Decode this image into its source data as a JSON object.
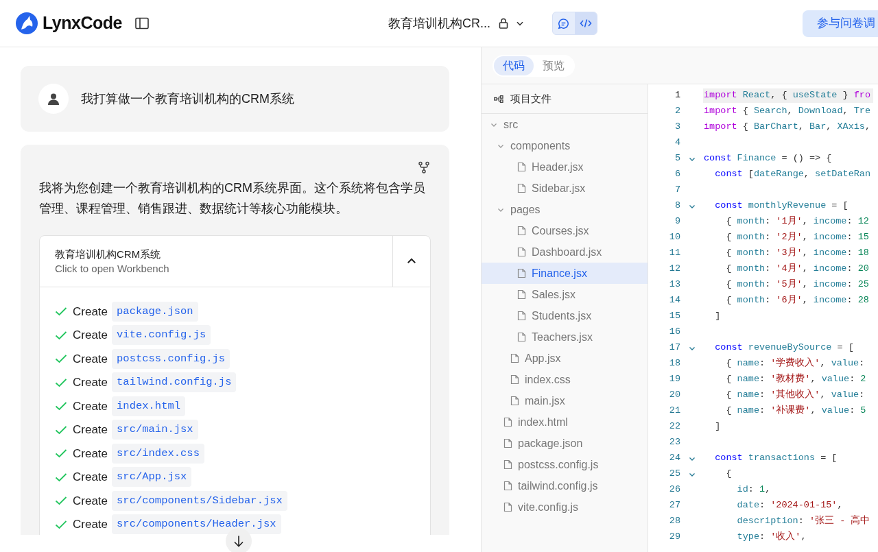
{
  "header": {
    "logo": "LynxCode",
    "project_title": "教育培训机构CR...",
    "view_toggle": [
      {
        "kind": "chat",
        "selected": false
      },
      {
        "kind": "code",
        "selected": true
      }
    ],
    "survey_button": "参与问卷调"
  },
  "chat": {
    "user_message": "我打算做一个教育培训机构的CRM系统",
    "assistant_message": "我将为您创建一个教育培训机构的CRM系统界面。这个系统将包含学员管理、课程管理、销售跟进、数据统计等核心功能模块。",
    "workbench": {
      "title": "教育培训机构CRM系统",
      "subtitle": "Click to open Workbench",
      "expanded": true,
      "steps": [
        {
          "action": "Create",
          "file": "package.json",
          "done": true
        },
        {
          "action": "Create",
          "file": "vite.config.js",
          "done": true
        },
        {
          "action": "Create",
          "file": "postcss.config.js",
          "done": true
        },
        {
          "action": "Create",
          "file": "tailwind.config.js",
          "done": true
        },
        {
          "action": "Create",
          "file": "index.html",
          "done": true
        },
        {
          "action": "Create",
          "file": "src/main.jsx",
          "done": true
        },
        {
          "action": "Create",
          "file": "src/index.css",
          "done": true
        },
        {
          "action": "Create",
          "file": "src/App.jsx",
          "done": true
        },
        {
          "action": "Create",
          "file": "src/components/Sidebar.jsx",
          "done": true
        },
        {
          "action": "Create",
          "file": "src/components/Header.jsx",
          "done": true
        }
      ]
    }
  },
  "tabs": [
    {
      "label": "代码",
      "selected": true
    },
    {
      "label": "预览",
      "selected": false
    }
  ],
  "file_tree": {
    "title": "项目文件",
    "items": [
      {
        "kind": "folder",
        "name": "src",
        "expanded": true,
        "children": [
          {
            "kind": "folder",
            "name": "components",
            "expanded": true,
            "children": [
              {
                "kind": "file",
                "name": "Header.jsx",
                "selected": false
              },
              {
                "kind": "file",
                "name": "Sidebar.jsx",
                "selected": false
              }
            ]
          },
          {
            "kind": "folder",
            "name": "pages",
            "expanded": true,
            "children": [
              {
                "kind": "file",
                "name": "Courses.jsx",
                "selected": false
              },
              {
                "kind": "file",
                "name": "Dashboard.jsx",
                "selected": false
              },
              {
                "kind": "file",
                "name": "Finance.jsx",
                "selected": true
              },
              {
                "kind": "file",
                "name": "Sales.jsx",
                "selected": false
              },
              {
                "kind": "file",
                "name": "Students.jsx",
                "selected": false
              },
              {
                "kind": "file",
                "name": "Teachers.jsx",
                "selected": false
              }
            ]
          },
          {
            "kind": "file",
            "name": "App.jsx",
            "selected": false
          },
          {
            "kind": "file",
            "name": "index.css",
            "selected": false
          },
          {
            "kind": "file",
            "name": "main.jsx",
            "selected": false
          }
        ]
      },
      {
        "kind": "file",
        "name": "index.html",
        "selected": false
      },
      {
        "kind": "file",
        "name": "package.json",
        "selected": false
      },
      {
        "kind": "file",
        "name": "postcss.config.js",
        "selected": false
      },
      {
        "kind": "file",
        "name": "tailwind.config.js",
        "selected": false
      },
      {
        "kind": "file",
        "name": "vite.config.js",
        "selected": false
      }
    ]
  },
  "code": {
    "lines": [
      {
        "no": "1",
        "foldable": false,
        "current": true,
        "tokens": [
          {
            "kind": "kw",
            "text": "import"
          },
          {
            "kind": "id",
            "text": " React"
          },
          {
            "kind": "p",
            "text": ", { "
          },
          {
            "kind": "id",
            "text": "useState"
          },
          {
            "kind": "p",
            "text": " } "
          },
          {
            "kind": "kw",
            "text": "fro"
          }
        ]
      },
      {
        "no": "2",
        "foldable": false,
        "current": false,
        "tokens": [
          {
            "kind": "kw",
            "text": "import"
          },
          {
            "kind": "p",
            "text": " { "
          },
          {
            "kind": "id",
            "text": "Search"
          },
          {
            "kind": "p",
            "text": ", "
          },
          {
            "kind": "id",
            "text": "Download"
          },
          {
            "kind": "p",
            "text": ", "
          },
          {
            "kind": "id",
            "text": "Tre"
          }
        ]
      },
      {
        "no": "3",
        "foldable": false,
        "current": false,
        "tokens": [
          {
            "kind": "kw",
            "text": "import"
          },
          {
            "kind": "p",
            "text": " { "
          },
          {
            "kind": "id",
            "text": "BarChart"
          },
          {
            "kind": "p",
            "text": ", "
          },
          {
            "kind": "id",
            "text": "Bar"
          },
          {
            "kind": "p",
            "text": ", "
          },
          {
            "kind": "id",
            "text": "XAxis"
          },
          {
            "kind": "p",
            "text": ","
          }
        ]
      },
      {
        "no": "4",
        "foldable": false,
        "current": false
      },
      {
        "no": "5",
        "foldable": true,
        "current": false,
        "tokens": [
          {
            "kind": "decl",
            "text": "const"
          },
          {
            "kind": "id",
            "text": " Finance"
          },
          {
            "kind": "p",
            "text": " = () => {"
          }
        ]
      },
      {
        "no": "6",
        "foldable": false,
        "current": false,
        "tokens": [
          {
            "kind": "decl",
            "text": "  const"
          },
          {
            "kind": "p",
            "text": " ["
          },
          {
            "kind": "id",
            "text": "dateRange"
          },
          {
            "kind": "p",
            "text": ", "
          },
          {
            "kind": "id",
            "text": "setDateRan"
          }
        ]
      },
      {
        "no": "7",
        "foldable": false,
        "current": false
      },
      {
        "no": "8",
        "foldable": true,
        "current": false,
        "tokens": [
          {
            "kind": "decl",
            "text": "  const"
          },
          {
            "kind": "id",
            "text": " monthlyRevenue"
          },
          {
            "kind": "p",
            "text": " = ["
          }
        ]
      },
      {
        "no": "9",
        "foldable": false,
        "current": false,
        "tokens": [
          {
            "kind": "p",
            "text": "    { "
          },
          {
            "kind": "id",
            "text": "month"
          },
          {
            "kind": "p",
            "text": ": "
          },
          {
            "kind": "str",
            "text": "'1月'"
          },
          {
            "kind": "p",
            "text": ", "
          },
          {
            "kind": "id",
            "text": "income"
          },
          {
            "kind": "p",
            "text": ": "
          },
          {
            "kind": "num",
            "text": "12"
          }
        ]
      },
      {
        "no": "10",
        "foldable": false,
        "current": false,
        "tokens": [
          {
            "kind": "p",
            "text": "    { "
          },
          {
            "kind": "id",
            "text": "month"
          },
          {
            "kind": "p",
            "text": ": "
          },
          {
            "kind": "str",
            "text": "'2月'"
          },
          {
            "kind": "p",
            "text": ", "
          },
          {
            "kind": "id",
            "text": "income"
          },
          {
            "kind": "p",
            "text": ": "
          },
          {
            "kind": "num",
            "text": "15"
          }
        ]
      },
      {
        "no": "11",
        "foldable": false,
        "current": false,
        "tokens": [
          {
            "kind": "p",
            "text": "    { "
          },
          {
            "kind": "id",
            "text": "month"
          },
          {
            "kind": "p",
            "text": ": "
          },
          {
            "kind": "str",
            "text": "'3月'"
          },
          {
            "kind": "p",
            "text": ", "
          },
          {
            "kind": "id",
            "text": "income"
          },
          {
            "kind": "p",
            "text": ": "
          },
          {
            "kind": "num",
            "text": "18"
          }
        ]
      },
      {
        "no": "12",
        "foldable": false,
        "current": false,
        "tokens": [
          {
            "kind": "p",
            "text": "    { "
          },
          {
            "kind": "id",
            "text": "month"
          },
          {
            "kind": "p",
            "text": ": "
          },
          {
            "kind": "str",
            "text": "'4月'"
          },
          {
            "kind": "p",
            "text": ", "
          },
          {
            "kind": "id",
            "text": "income"
          },
          {
            "kind": "p",
            "text": ": "
          },
          {
            "kind": "num",
            "text": "20"
          }
        ]
      },
      {
        "no": "13",
        "foldable": false,
        "current": false,
        "tokens": [
          {
            "kind": "p",
            "text": "    { "
          },
          {
            "kind": "id",
            "text": "month"
          },
          {
            "kind": "p",
            "text": ": "
          },
          {
            "kind": "str",
            "text": "'5月'"
          },
          {
            "kind": "p",
            "text": ", "
          },
          {
            "kind": "id",
            "text": "income"
          },
          {
            "kind": "p",
            "text": ": "
          },
          {
            "kind": "num",
            "text": "25"
          }
        ]
      },
      {
        "no": "14",
        "foldable": false,
        "current": false,
        "tokens": [
          {
            "kind": "p",
            "text": "    { "
          },
          {
            "kind": "id",
            "text": "month"
          },
          {
            "kind": "p",
            "text": ": "
          },
          {
            "kind": "str",
            "text": "'6月'"
          },
          {
            "kind": "p",
            "text": ", "
          },
          {
            "kind": "id",
            "text": "income"
          },
          {
            "kind": "p",
            "text": ": "
          },
          {
            "kind": "num",
            "text": "28"
          }
        ]
      },
      {
        "no": "15",
        "foldable": false,
        "current": false,
        "tokens": [
          {
            "kind": "p",
            "text": "  ]"
          }
        ]
      },
      {
        "no": "16",
        "foldable": false,
        "current": false
      },
      {
        "no": "17",
        "foldable": true,
        "current": false,
        "tokens": [
          {
            "kind": "decl",
            "text": "  const"
          },
          {
            "kind": "id",
            "text": " revenueBySource"
          },
          {
            "kind": "p",
            "text": " = ["
          }
        ]
      },
      {
        "no": "18",
        "foldable": false,
        "current": false,
        "tokens": [
          {
            "kind": "p",
            "text": "    { "
          },
          {
            "kind": "id",
            "text": "name"
          },
          {
            "kind": "p",
            "text": ": "
          },
          {
            "kind": "str",
            "text": "'学费收入'"
          },
          {
            "kind": "p",
            "text": ", "
          },
          {
            "kind": "id",
            "text": "value"
          },
          {
            "kind": "p",
            "text": ":"
          }
        ]
      },
      {
        "no": "19",
        "foldable": false,
        "current": false,
        "tokens": [
          {
            "kind": "p",
            "text": "    { "
          },
          {
            "kind": "id",
            "text": "name"
          },
          {
            "kind": "p",
            "text": ": "
          },
          {
            "kind": "str",
            "text": "'教材费'"
          },
          {
            "kind": "p",
            "text": ", "
          },
          {
            "kind": "id",
            "text": "value"
          },
          {
            "kind": "p",
            "text": ": "
          },
          {
            "kind": "num",
            "text": "2"
          }
        ]
      },
      {
        "no": "20",
        "foldable": false,
        "current": false,
        "tokens": [
          {
            "kind": "p",
            "text": "    { "
          },
          {
            "kind": "id",
            "text": "name"
          },
          {
            "kind": "p",
            "text": ": "
          },
          {
            "kind": "str",
            "text": "'其他收入'"
          },
          {
            "kind": "p",
            "text": ", "
          },
          {
            "kind": "id",
            "text": "value"
          },
          {
            "kind": "p",
            "text": ":"
          }
        ]
      },
      {
        "no": "21",
        "foldable": false,
        "current": false,
        "tokens": [
          {
            "kind": "p",
            "text": "    { "
          },
          {
            "kind": "id",
            "text": "name"
          },
          {
            "kind": "p",
            "text": ": "
          },
          {
            "kind": "str",
            "text": "'补课费'"
          },
          {
            "kind": "p",
            "text": ", "
          },
          {
            "kind": "id",
            "text": "value"
          },
          {
            "kind": "p",
            "text": ": "
          },
          {
            "kind": "num",
            "text": "5"
          }
        ]
      },
      {
        "no": "22",
        "foldable": false,
        "current": false,
        "tokens": [
          {
            "kind": "p",
            "text": "  ]"
          }
        ]
      },
      {
        "no": "23",
        "foldable": false,
        "current": false
      },
      {
        "no": "24",
        "foldable": true,
        "current": false,
        "tokens": [
          {
            "kind": "decl",
            "text": "  const"
          },
          {
            "kind": "id",
            "text": " transactions"
          },
          {
            "kind": "p",
            "text": " = ["
          }
        ]
      },
      {
        "no": "25",
        "foldable": true,
        "current": false,
        "tokens": [
          {
            "kind": "p",
            "text": "    {"
          }
        ]
      },
      {
        "no": "26",
        "foldable": false,
        "current": false,
        "tokens": [
          {
            "kind": "id",
            "text": "      id"
          },
          {
            "kind": "p",
            "text": ": "
          },
          {
            "kind": "num",
            "text": "1"
          },
          {
            "kind": "p",
            "text": ","
          }
        ]
      },
      {
        "no": "27",
        "foldable": false,
        "current": false,
        "tokens": [
          {
            "kind": "id",
            "text": "      date"
          },
          {
            "kind": "p",
            "text": ": "
          },
          {
            "kind": "str",
            "text": "'2024-01-15'"
          },
          {
            "kind": "p",
            "text": ","
          }
        ]
      },
      {
        "no": "28",
        "foldable": false,
        "current": false,
        "tokens": [
          {
            "kind": "id",
            "text": "      description"
          },
          {
            "kind": "p",
            "text": ": "
          },
          {
            "kind": "str",
            "text": "'张三 - 高中"
          }
        ]
      },
      {
        "no": "29",
        "foldable": false,
        "current": false,
        "tokens": [
          {
            "kind": "id",
            "text": "      type"
          },
          {
            "kind": "p",
            "text": ": "
          },
          {
            "kind": "str",
            "text": "'收入'"
          },
          {
            "kind": "p",
            "text": ","
          }
        ]
      }
    ]
  }
}
